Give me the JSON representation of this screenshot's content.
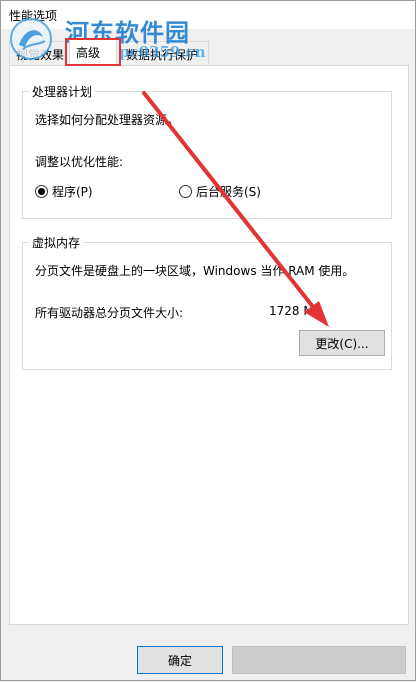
{
  "window": {
    "title": "性能选项"
  },
  "watermark": {
    "text": "河东软件园",
    "url": "pc0359.cn"
  },
  "tabs": [
    {
      "label": "视觉效果",
      "active": false
    },
    {
      "label": "高级",
      "active": true
    },
    {
      "label": "数据执行保护",
      "active": false
    }
  ],
  "processor": {
    "legend": "处理器计划",
    "description": "选择如何分配处理器资源。",
    "adjust_label": "调整以优化性能:",
    "options": [
      {
        "label": "程序(P)",
        "checked": true
      },
      {
        "label": "后台服务(S)",
        "checked": false
      }
    ]
  },
  "virtual_memory": {
    "legend": "虚拟内存",
    "description": "分页文件是硬盘上的一块区域，Windows 当作 RAM 使用。",
    "total_label": "所有驱动器总分页文件大小:",
    "total_value": "1728 MB",
    "change_button": "更改(C)..."
  },
  "footer": {
    "ok_button": "确定",
    "cancel_button": ""
  },
  "colors": {
    "highlight": "#e23434",
    "watermark": "#1f7fd0",
    "focus_border": "#0078d7"
  }
}
